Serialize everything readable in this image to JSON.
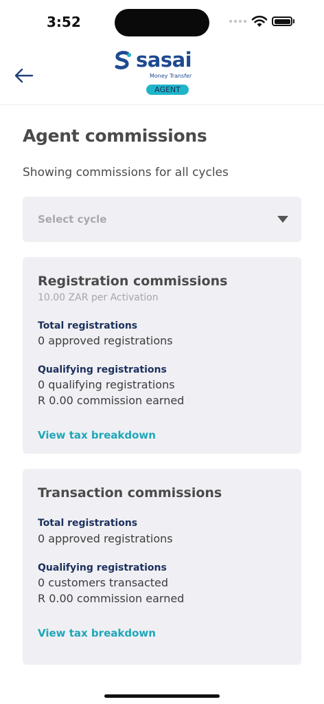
{
  "status_bar": {
    "time": "3:52"
  },
  "header": {
    "brand_name": "sasai",
    "brand_sub": "Money Transfer",
    "brand_badge": "AGENT"
  },
  "page": {
    "title": "Agent commissions",
    "subtitle": "Showing commissions for all cycles",
    "select_cycle_placeholder": "Select cycle"
  },
  "registration_card": {
    "title": "Registration commissions",
    "rate_note": "10.00 ZAR per Activation",
    "total_label": "Total registrations",
    "total_value": "0 approved registrations",
    "qualifying_label": "Qualifying registrations",
    "qualifying_value": "0 qualifying registrations",
    "commission_value": "R 0.00 commission earned",
    "link": "View tax breakdown"
  },
  "transaction_card": {
    "title": "Transaction commissions",
    "total_label": "Total registrations",
    "total_value": "0 approved registrations",
    "qualifying_label": "Qualifying registrations",
    "qualifying_value": "0 customers transacted",
    "commission_value": "R 0.00 commission earned",
    "link": "View tax breakdown"
  },
  "colors": {
    "brand_blue": "#1f4a8f",
    "brand_teal": "#1fb5c9",
    "label_navy": "#1c2f5c",
    "link_teal": "#1ea7b8",
    "card_bg": "#f0f0f4"
  },
  "icons": {
    "back": "arrow-left-icon",
    "wifi": "wifi-icon",
    "battery": "battery-icon",
    "caret": "chevron-down-icon"
  }
}
